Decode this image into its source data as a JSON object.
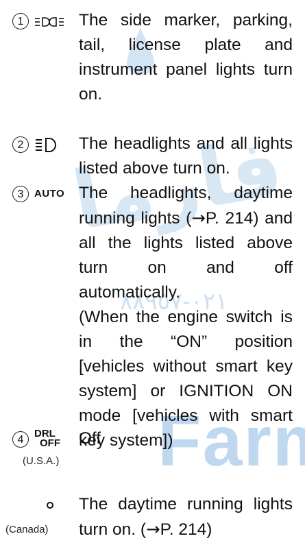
{
  "watermark": {
    "arabic_text": "فارما",
    "number_text": "٠٢١-٨٨٩٥٧",
    "brand_text": "FarmaS"
  },
  "items": [
    {
      "number": "1",
      "symbol_icon": "parking-lights-icon",
      "text": "The side marker, parking, tail, license plate and instrument panel lights turn on."
    },
    {
      "number": "2",
      "symbol_icon": "headlight-icon",
      "text": "The headlights and all lights listed above turn on."
    },
    {
      "number": "3",
      "symbol_text": "AUTO",
      "text_a": "The headlights, daytime running lights (",
      "arrow": "→",
      "text_b": "P. 214) and all the lights listed above turn on and off automatically.",
      "note": "(When the engine switch is in the “ON” position [vehicles without smart key system] or IGNITION ON mode [vehicles with smart key system])"
    },
    {
      "number": "4",
      "symbol_line1": "DRL",
      "symbol_line2": "OFF",
      "region": "(U.S.A.)",
      "text": "Off"
    },
    {
      "symbol_icon": "circle-icon",
      "region": "(Canada)",
      "text_a": "The daytime running lights turn on. (",
      "arrow": "→",
      "text_b": "P. 214)"
    }
  ]
}
